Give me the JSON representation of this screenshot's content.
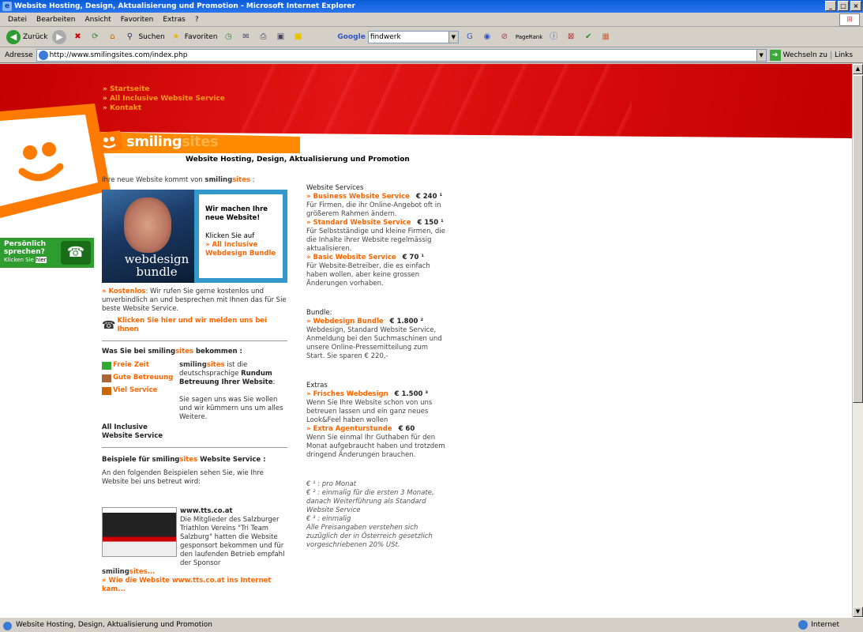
{
  "window": {
    "title": "Website Hosting, Design, Aktualisierung und Promotion - Microsoft Internet Explorer",
    "min": "_",
    "max": "□",
    "close": "×"
  },
  "menu": [
    "Datei",
    "Bearbeiten",
    "Ansicht",
    "Favoriten",
    "Extras",
    "?"
  ],
  "toolbar": {
    "back": "Zurück",
    "search": "Suchen",
    "favorites": "Favoriten",
    "google_label": "Google",
    "google_value": "findwerk",
    "pagerank": "PageRank"
  },
  "address": {
    "label": "Adresse",
    "url": "http://www.smilingsites.com/index.php",
    "go": "Wechseln zu",
    "links": "Links"
  },
  "status": {
    "text": "Website Hosting, Design, Aktualisierung und Promotion",
    "zone": "Internet"
  },
  "nav": [
    "Startseite",
    "All Inclusive Website Service",
    "Kontakt"
  ],
  "logo": {
    "smiling": "smiling",
    "sites": "sites"
  },
  "tagline": "Website Hosting, Design, Aktualisierung und Promotion",
  "callbox": {
    "line1": "Persönlich",
    "line2": "sprechen?",
    "small_prefix": "Klicken Sie",
    "small_link": "hier"
  },
  "left": {
    "intro_pre": "Ihre neue Website kommt von ",
    "intro_smiling": "smiling",
    "intro_sites": "sites",
    "intro_post": " :",
    "photo_caption": "webdesign bundle",
    "promo_head": "Wir machen Ihre neue Website!",
    "promo_click": "Klicken Sie auf",
    "promo_link": "All Inclusive Webdesign Bundle",
    "free_link": "Kostenlos",
    "free_text": ": Wir rufen Sie gerne kostenlos und unverbindlich an und besprechen mit Ihnen das für Sie beste Website Service.",
    "call_link": "Klicken Sie hier und wir melden uns bei Ihnen",
    "what_pre": "Was Sie bei ",
    "what_smiling": "smiling",
    "what_sites": "sites",
    "what_post": " bekommen :",
    "features": [
      "Freie Zeit",
      "Gute Betreuung",
      "Viel Service"
    ],
    "desc1_smiling": "smiling",
    "desc1_sites": "sites",
    "desc1_text": " ist die deutschsprachige ",
    "desc1_bold": "Rundum Betreuung Ihrer Website",
    "desc1_end": ":",
    "desc2": "Sie sagen uns was Sie wollen und wir kümmern uns um alles Weitere.",
    "allinc": "All Inclusive Website Service",
    "examples_pre": "Beispiele für ",
    "examples_smiling": "smiling",
    "examples_sites": "sites",
    "examples_post": " Website Service :",
    "examples_intro": "An den folgenden Beispielen sehen Sie, wie Ihre Website bei uns betreut wird:",
    "ex_title": "www.tts.co.at",
    "ex_text": "Die Mitglieder des Salzburger Triathlon Vereins \"Tri Team Salzburg\" hatten die Website gesponsort bekommen und für den laufenden Betrieb empfahl der Sponsor ",
    "ex_smiling": "smiling",
    "ex_sites": "sites...",
    "ex_link": "Wie die Website www.tts.co.at ins Internet kam..."
  },
  "right": {
    "services_title": "Website Services",
    "services": [
      {
        "name": "Business Website Service",
        "price": "€ 240 ¹",
        "desc": "Für Firmen, die ihr Online-Angebot oft in größerem Rahmen ändern."
      },
      {
        "name": "Standard Website Service",
        "price": "€ 150 ¹",
        "desc": "Für Selbstständige und kleine Firmen, die die Inhalte ihrer Website regelmässig aktualisieren."
      },
      {
        "name": "Basic Website Service",
        "price": "€ 70 ¹",
        "desc": "Für Website-Betreiber, die es einfach haben wollen, aber keine grossen Änderungen vorhaben."
      }
    ],
    "bundle_title": "Bundle:",
    "bundle": {
      "name": "Webdesign Bundle",
      "price": "€ 1.800 ²",
      "desc": "Webdesign, Standard Website Service, Anmeldung bei den Suchmaschinen und unsere Online-Pressemitteilung zum Start. Sie sparen € 220,-"
    },
    "extras_title": "Extras",
    "extras": [
      {
        "name": "Frisches Webdesign",
        "price": "€ 1.500 ³",
        "desc": "Wenn Sie Ihre Website schon von uns betreuen lassen und ein ganz neues Look&Feel haben wollen"
      },
      {
        "name": "Extra Agenturstunde",
        "price": "€ 60",
        "desc": "Wenn Sie einmal Ihr Guthaben für den Monat aufgebraucht haben und trotzdem dringend Änderungen brauchen."
      }
    ],
    "footnotes": [
      "€ ¹ : pro Monat",
      "€ ² : einmalig für die ersten 3 Monate, danach Weiterführung als Standard Website Service",
      "€ ³ : einmalig",
      "Alle Preisangaben verstehen sich zuzüglich der in Österreich gesetzlich vorgeschriebenen 20% USt."
    ]
  }
}
